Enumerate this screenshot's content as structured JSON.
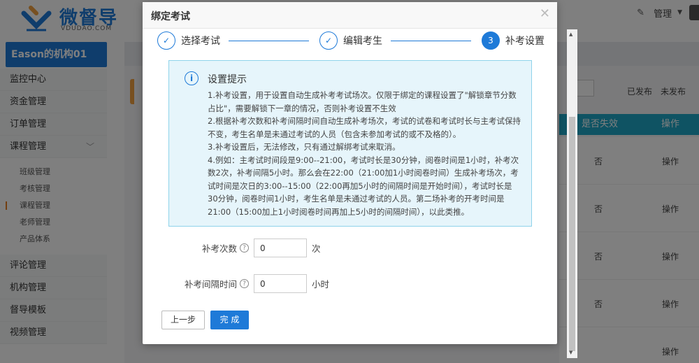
{
  "app": {
    "logo_text": "微督导",
    "logo_sub": "VDUDAO.COM",
    "admin_label": "管理"
  },
  "sidebar": {
    "org_title": "Eason的机构01",
    "items": [
      {
        "label": "监控中心"
      },
      {
        "label": "资金管理"
      },
      {
        "label": "订单管理"
      },
      {
        "label": "课程管理"
      }
    ],
    "sub_items": [
      {
        "label": "班级管理"
      },
      {
        "label": "考核管理"
      },
      {
        "label": "课程管理"
      },
      {
        "label": "老师管理"
      },
      {
        "label": "产品体系"
      }
    ],
    "items_after": [
      {
        "label": "评论管理"
      },
      {
        "label": "机构管理"
      },
      {
        "label": "督导模板"
      },
      {
        "label": "视频管理"
      }
    ]
  },
  "background": {
    "publish_tabs": [
      "已发布",
      "未发布"
    ],
    "table_headers": [
      "是否失效",
      "操作"
    ],
    "rows": [
      {
        "expired": "否",
        "action": "操作"
      },
      {
        "expired": "否",
        "action": "操作"
      },
      {
        "expired": "否",
        "action": "操作"
      },
      {
        "expired": "否",
        "action": "操作"
      },
      {
        "expired": "",
        "action": "操作"
      }
    ]
  },
  "modal": {
    "title": "绑定考试",
    "steps": [
      {
        "label": "选择考试",
        "marker": "✓"
      },
      {
        "label": "编辑考生",
        "marker": "✓"
      },
      {
        "label": "补考设置",
        "marker": "3"
      }
    ],
    "tip": {
      "title": "设置提示",
      "lines": [
        "1.补考设置，用于设置自动生成补考考试场次。仅限于绑定的课程设置了\"解锁章节分数占比\"，需要解锁下一章的情况，否则补考设置不生效",
        "2.根据补考次数和补考间隔时间自动生成补考场次，考试的试卷和考试时长与主考试保持不变，考生名单是未通过考试的人员（包含未参加考试的或不及格的）。",
        "3.补考设置后，无法修改，只有通过解绑考试来取消。",
        "4.例如：主考试时间段是9:00--21:00，考试时长是30分钟，阅卷时间是1小时，补考次数2次，补考间隔5小时。那么会在22:00（21:00加1小时阅卷时间）生成补考场次，考试时间是次日的3:00--15:00（22:00再加5小时的间隔时间是开始时间），考试时长是30分钟，阅卷时间1小时，考生名单是未通过考试的人员。第二场补考的开考时间是21:00（15:00加上1小时阅卷时间再加上5小时的间隔时间），以此类推。"
      ]
    },
    "fields": {
      "retake_count_label": "补考次数",
      "retake_count_value": "0",
      "retake_count_unit": "次",
      "retake_interval_label": "补考间隔时间",
      "retake_interval_value": "0",
      "retake_interval_unit": "小时"
    },
    "buttons": {
      "prev": "上一步",
      "done": "完 成"
    }
  }
}
